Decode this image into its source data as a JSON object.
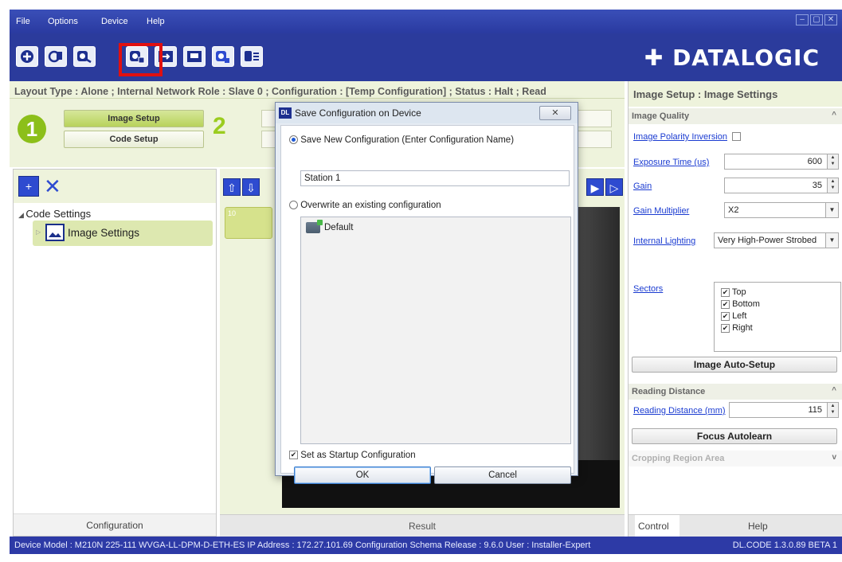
{
  "menu": [
    "File",
    "Options",
    "Device",
    "Help"
  ],
  "window_controls": [
    "–",
    "▢",
    "✕"
  ],
  "brand": "DATALOGIC",
  "layout_info": "Layout Type : Alone ; Internal Network Role : Slave 0 ; Configuration : [Temp Configuration] ; Status : Halt ; Read",
  "steps": {
    "step1_number": "1",
    "step1_buttons": [
      "Image Setup",
      "Code Setup"
    ],
    "step2_number": "2"
  },
  "left_panel": {
    "tree_root": "Code Settings",
    "tree_child": "Image Settings",
    "footer": "Configuration"
  },
  "middle_panel": {
    "thumb_index": "10",
    "footer": "Result"
  },
  "right_panel": {
    "title": "Image Setup : Image Settings",
    "image_quality": {
      "section": "Image Quality",
      "polarity_label": "Image Polarity Inversion",
      "exposure_label": "Exposure Time (us)",
      "exposure_value": "600",
      "gain_label": "Gain",
      "gain_value": "35",
      "gain_mult_label": "Gain Multiplier",
      "gain_mult_value": "X2",
      "lighting_label": "Internal Lighting",
      "lighting_value": "Very High-Power Strobed",
      "sectors_label": "Sectors",
      "sectors": [
        "Top",
        "Bottom",
        "Left",
        "Right"
      ],
      "auto_setup_button": "Image Auto-Setup"
    },
    "reading_distance": {
      "section": "Reading Distance",
      "label": "Reading Distance (mm)",
      "value": "115",
      "focus_button": "Focus Autolearn"
    },
    "cropping_section": "Cropping Region Area",
    "tabs": [
      "Control",
      "Help"
    ]
  },
  "status_bar": {
    "left": "Device Model : M210N 225-111 WVGA-LL-DPM-D-ETH-ES   IP Address : 172.27.101.69   Configuration Schema Release : 9.6.0   User : Installer-Expert",
    "right": "DL.CODE 1.3.0.89 BETA 1"
  },
  "dialog": {
    "title": "Save Configuration on Device",
    "close": "✕",
    "option_new": "Save New Configuration (Enter Configuration Name)",
    "name_value": "Station 1",
    "option_overwrite": "Overwrite an existing configuration",
    "existing": [
      "Default"
    ],
    "startup_label": "Set as Startup Configuration",
    "ok": "OK",
    "cancel": "Cancel"
  }
}
